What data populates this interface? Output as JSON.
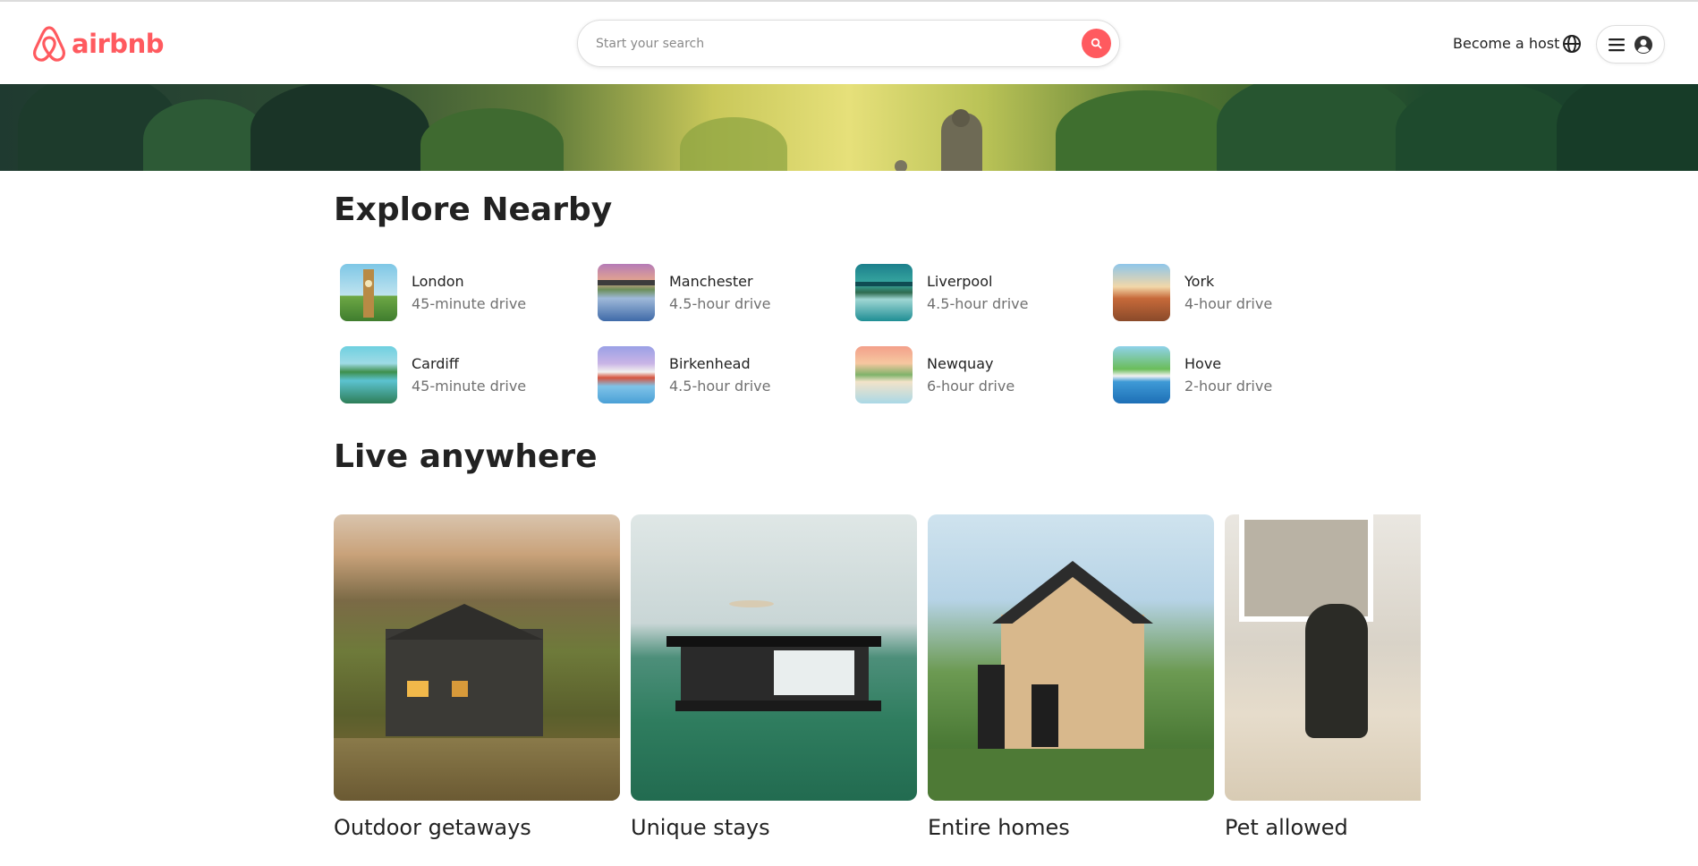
{
  "header": {
    "logo_text": "airbnb",
    "search_placeholder": "Start your search",
    "host_label": "Become a host"
  },
  "colors": {
    "brand": "#ff5a5f",
    "text": "#222222",
    "muted": "#717171"
  },
  "explore": {
    "title": "Explore Nearby",
    "items": [
      {
        "city": "London",
        "drive": "45-minute drive"
      },
      {
        "city": "Manchester",
        "drive": "4.5-hour drive"
      },
      {
        "city": "Liverpool",
        "drive": "4.5-hour drive"
      },
      {
        "city": "York",
        "drive": "4-hour drive"
      },
      {
        "city": "Cardiff",
        "drive": "45-minute drive"
      },
      {
        "city": "Birkenhead",
        "drive": "4.5-hour drive"
      },
      {
        "city": "Newquay",
        "drive": "6-hour drive"
      },
      {
        "city": "Hove",
        "drive": "2-hour drive"
      }
    ]
  },
  "live": {
    "title": "Live anywhere",
    "cards": [
      {
        "label": "Outdoor getaways"
      },
      {
        "label": "Unique stays"
      },
      {
        "label": "Entire homes"
      },
      {
        "label": "Pet allowed"
      }
    ]
  }
}
